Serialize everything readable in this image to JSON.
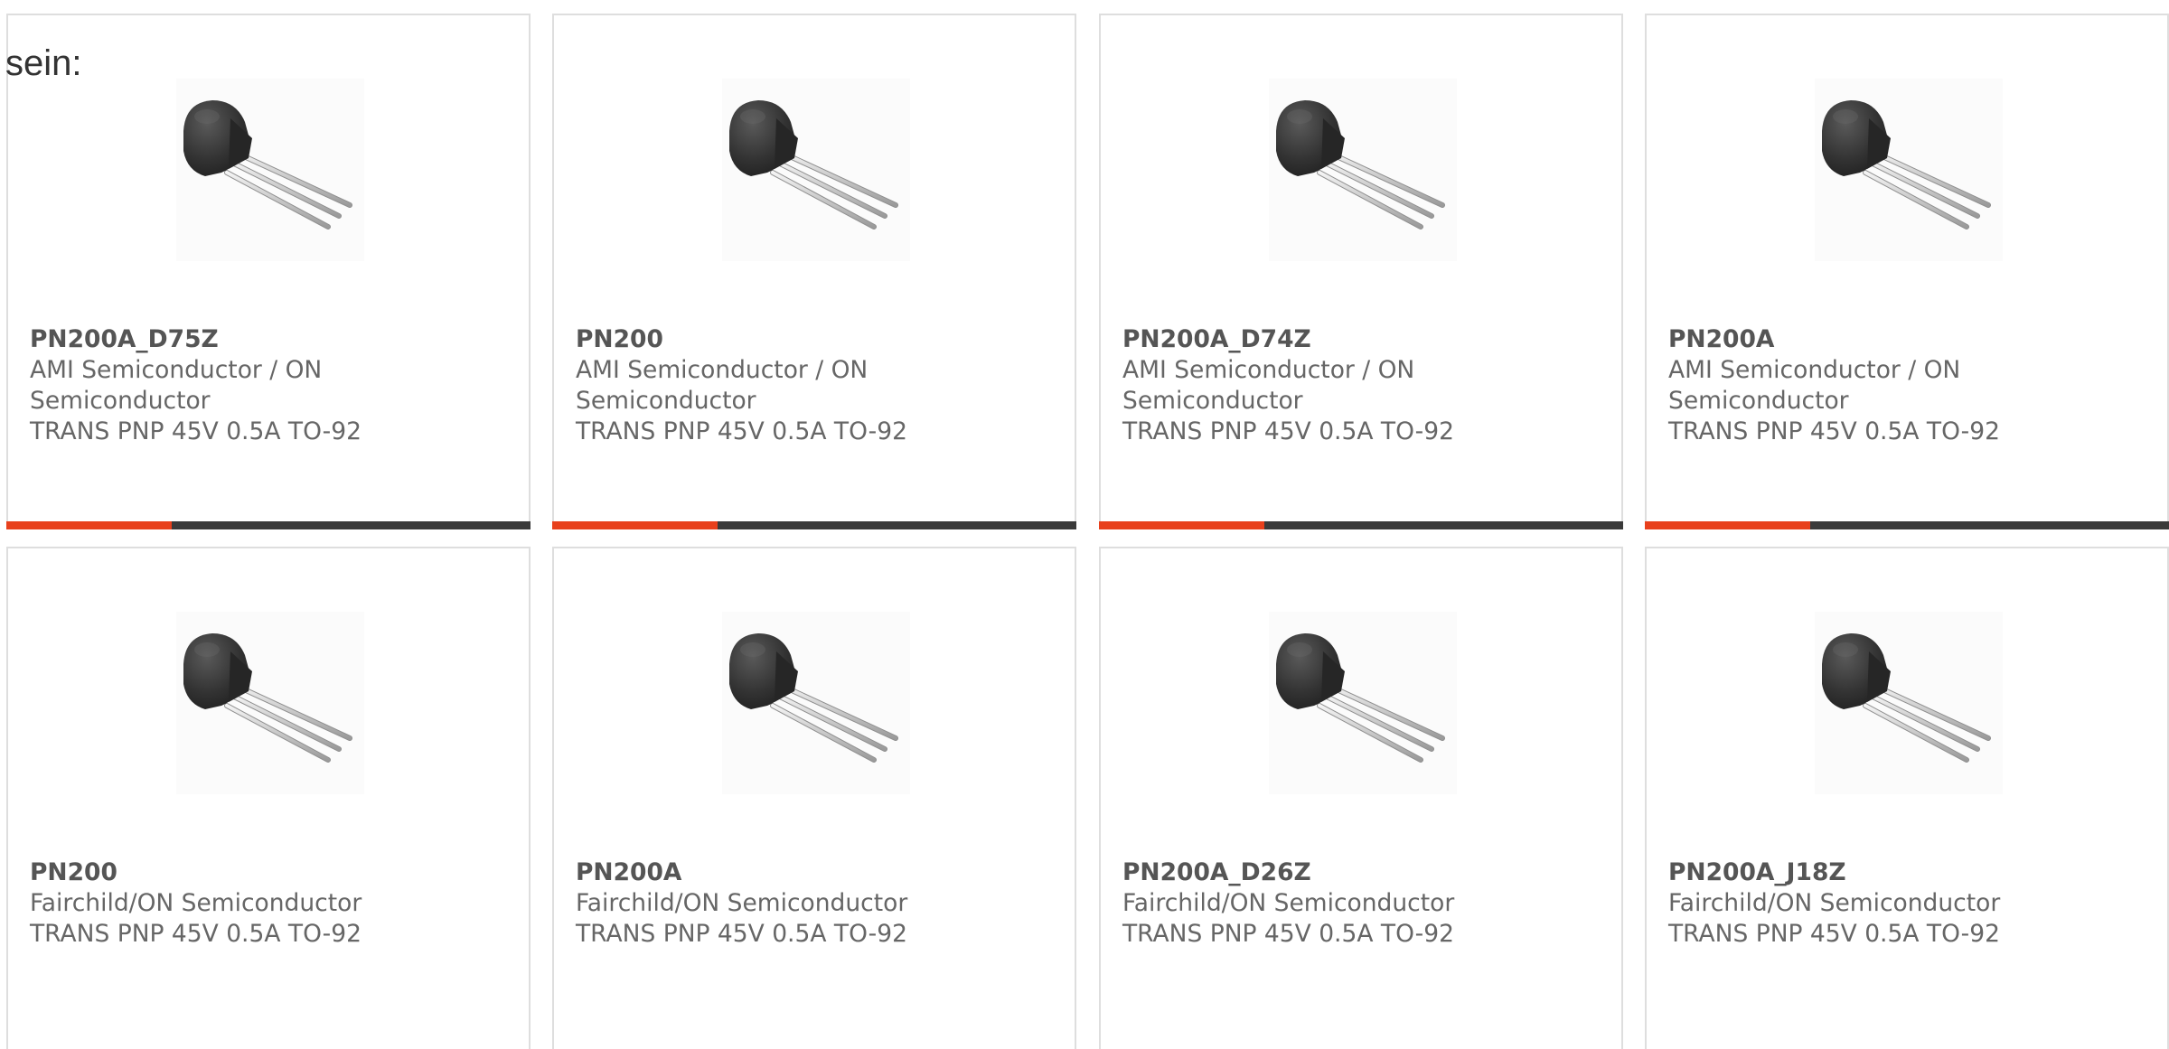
{
  "intro": {
    "text": "sein:"
  },
  "products": [
    {
      "part_number": "PN200A_D75Z",
      "manufacturer": "AMI Semiconductor / ON Semiconductor",
      "description": "TRANS PNP 45V 0.5A TO-92"
    },
    {
      "part_number": "PN200",
      "manufacturer": "AMI Semiconductor / ON Semiconductor",
      "description": "TRANS PNP 45V 0.5A TO-92"
    },
    {
      "part_number": "PN200A_D74Z",
      "manufacturer": "AMI Semiconductor / ON Semiconductor",
      "description": "TRANS PNP 45V 0.5A TO-92"
    },
    {
      "part_number": "PN200A",
      "manufacturer": "AMI Semiconductor / ON Semiconductor",
      "description": "TRANS PNP 45V 0.5A TO-92"
    },
    {
      "part_number": "PN200",
      "manufacturer": "Fairchild/ON Semiconductor",
      "description": "TRANS PNP 45V 0.5A TO-92"
    },
    {
      "part_number": "PN200A",
      "manufacturer": "Fairchild/ON Semiconductor",
      "description": "TRANS PNP 45V 0.5A TO-92"
    },
    {
      "part_number": "PN200A_D26Z",
      "manufacturer": "Fairchild/ON Semiconductor",
      "description": "TRANS PNP 45V 0.5A TO-92"
    },
    {
      "part_number": "PN200A_J18Z",
      "manufacturer": "Fairchild/ON Semiconductor",
      "description": "TRANS PNP 45V 0.5A TO-92"
    }
  ],
  "image_icon": "to92-transistor-image",
  "colors": {
    "accent": "#e8401c",
    "bar": "#3a3a3a",
    "border": "#dedede",
    "text": "#666666"
  }
}
